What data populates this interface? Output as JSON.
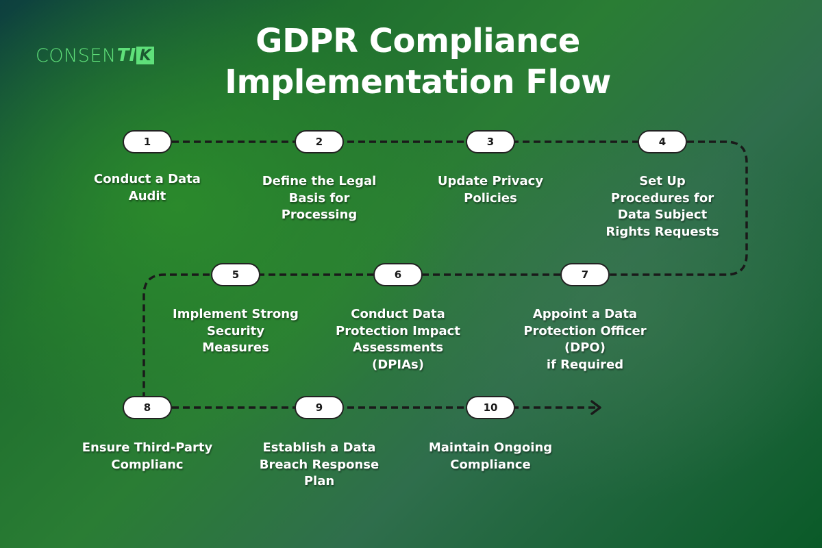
{
  "logo": {
    "text_light": "CONSEN",
    "text_bold": "TI",
    "text_badge": "K"
  },
  "title": {
    "line1": "GDPR Compliance",
    "line2": "Implementation Flow"
  },
  "flow": {
    "direction": "snake: row 1 left-to-right, row 2 right-to-left, row 3 left-to-right ending in arrow",
    "steps": [
      {
        "number": "1",
        "label": "Conduct a Data Audit"
      },
      {
        "number": "2",
        "label": "Define the Legal Basis for Processing"
      },
      {
        "number": "3",
        "label": "Update Privacy Policies"
      },
      {
        "number": "4",
        "label": "Set Up Procedures for Data Subject Rights Requests"
      },
      {
        "number": "5",
        "label": "Implement Strong Security Measures"
      },
      {
        "number": "6",
        "label": "Conduct Data Protection Impact Assessments (DPIAs)"
      },
      {
        "number": "7",
        "label": "Appoint a Data Protection Officer (DPO) if Required"
      },
      {
        "number": "8",
        "label": "Ensure Third-Party Complianc"
      },
      {
        "number": "9",
        "label": "Establish a Data Breach Response Plan"
      },
      {
        "number": "10",
        "label": "Maintain Ongoing Compliance"
      }
    ]
  },
  "colors": {
    "logo_green": "#5fe07a",
    "pill_fill": "#ffffff",
    "connector": "#1a1a1a",
    "text": "#ffffff"
  }
}
